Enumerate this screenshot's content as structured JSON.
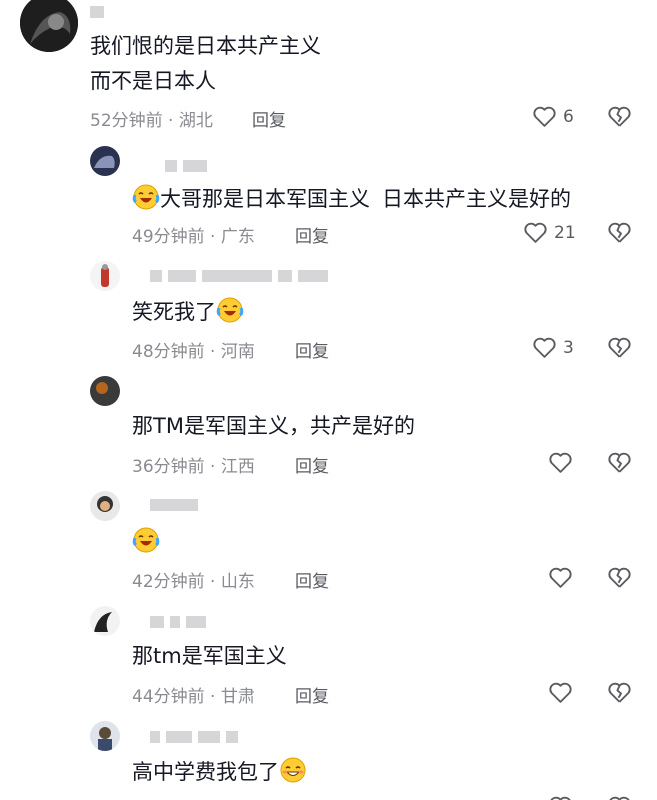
{
  "comment": {
    "lines": [
      "我们恨的是日本共产主义",
      "而不是日本人"
    ],
    "time": "52分钟前",
    "location": "湖北",
    "reply_label": "回复",
    "likes": "6"
  },
  "replies": [
    {
      "text_before": "",
      "text_after": "大哥那是日本军国主义",
      "text_tail": "日本共产主义是好的",
      "emoji": "laugh-cry",
      "emoji_pos": "start",
      "time": "49分钟前",
      "location": "广东",
      "reply_label": "回复",
      "likes": "21"
    },
    {
      "text_before": "笑死我了",
      "emoji": "laugh-cry",
      "emoji_pos": "end",
      "time": "48分钟前",
      "location": "河南",
      "reply_label": "回复",
      "likes": "3"
    },
    {
      "text_before": "那TM是军国主义，共产是好的",
      "time": "36分钟前",
      "location": "江西",
      "reply_label": "回复",
      "likes": ""
    },
    {
      "text_before": "",
      "emoji": "laugh-cry",
      "emoji_pos": "only",
      "time": "42分钟前",
      "location": "山东",
      "reply_label": "回复",
      "likes": ""
    },
    {
      "text_before": "那tm是军国主义",
      "time": "44分钟前",
      "location": "甘肃",
      "reply_label": "回复",
      "likes": ""
    },
    {
      "text_before": "高中学费我包了",
      "emoji": "grin-blush",
      "emoji_pos": "end"
    }
  ],
  "separator": "·",
  "icons": {
    "like": "heart-outline-icon",
    "dislike": "broken-heart-icon"
  }
}
